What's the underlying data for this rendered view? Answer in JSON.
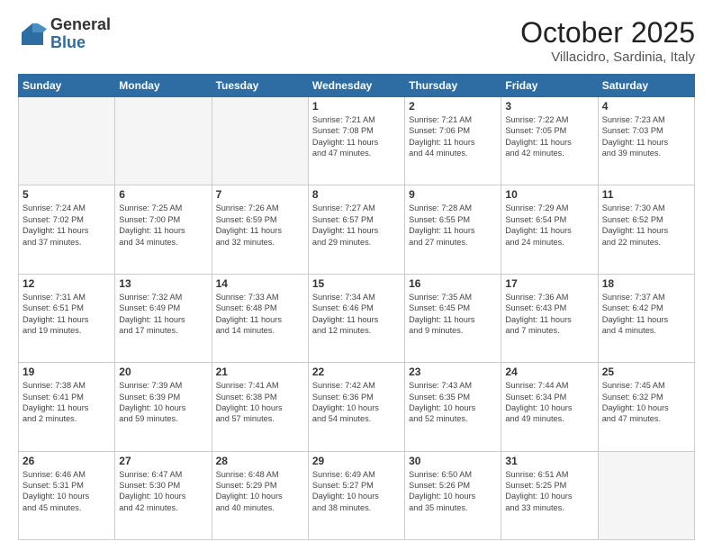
{
  "header": {
    "logo_general": "General",
    "logo_blue": "Blue",
    "month_title": "October 2025",
    "location": "Villacidro, Sardinia, Italy"
  },
  "days_of_week": [
    "Sunday",
    "Monday",
    "Tuesday",
    "Wednesday",
    "Thursday",
    "Friday",
    "Saturday"
  ],
  "weeks": [
    [
      {
        "day": "",
        "info": ""
      },
      {
        "day": "",
        "info": ""
      },
      {
        "day": "",
        "info": ""
      },
      {
        "day": "1",
        "info": "Sunrise: 7:21 AM\nSunset: 7:08 PM\nDaylight: 11 hours\nand 47 minutes."
      },
      {
        "day": "2",
        "info": "Sunrise: 7:21 AM\nSunset: 7:06 PM\nDaylight: 11 hours\nand 44 minutes."
      },
      {
        "day": "3",
        "info": "Sunrise: 7:22 AM\nSunset: 7:05 PM\nDaylight: 11 hours\nand 42 minutes."
      },
      {
        "day": "4",
        "info": "Sunrise: 7:23 AM\nSunset: 7:03 PM\nDaylight: 11 hours\nand 39 minutes."
      }
    ],
    [
      {
        "day": "5",
        "info": "Sunrise: 7:24 AM\nSunset: 7:02 PM\nDaylight: 11 hours\nand 37 minutes."
      },
      {
        "day": "6",
        "info": "Sunrise: 7:25 AM\nSunset: 7:00 PM\nDaylight: 11 hours\nand 34 minutes."
      },
      {
        "day": "7",
        "info": "Sunrise: 7:26 AM\nSunset: 6:59 PM\nDaylight: 11 hours\nand 32 minutes."
      },
      {
        "day": "8",
        "info": "Sunrise: 7:27 AM\nSunset: 6:57 PM\nDaylight: 11 hours\nand 29 minutes."
      },
      {
        "day": "9",
        "info": "Sunrise: 7:28 AM\nSunset: 6:55 PM\nDaylight: 11 hours\nand 27 minutes."
      },
      {
        "day": "10",
        "info": "Sunrise: 7:29 AM\nSunset: 6:54 PM\nDaylight: 11 hours\nand 24 minutes."
      },
      {
        "day": "11",
        "info": "Sunrise: 7:30 AM\nSunset: 6:52 PM\nDaylight: 11 hours\nand 22 minutes."
      }
    ],
    [
      {
        "day": "12",
        "info": "Sunrise: 7:31 AM\nSunset: 6:51 PM\nDaylight: 11 hours\nand 19 minutes."
      },
      {
        "day": "13",
        "info": "Sunrise: 7:32 AM\nSunset: 6:49 PM\nDaylight: 11 hours\nand 17 minutes."
      },
      {
        "day": "14",
        "info": "Sunrise: 7:33 AM\nSunset: 6:48 PM\nDaylight: 11 hours\nand 14 minutes."
      },
      {
        "day": "15",
        "info": "Sunrise: 7:34 AM\nSunset: 6:46 PM\nDaylight: 11 hours\nand 12 minutes."
      },
      {
        "day": "16",
        "info": "Sunrise: 7:35 AM\nSunset: 6:45 PM\nDaylight: 11 hours\nand 9 minutes."
      },
      {
        "day": "17",
        "info": "Sunrise: 7:36 AM\nSunset: 6:43 PM\nDaylight: 11 hours\nand 7 minutes."
      },
      {
        "day": "18",
        "info": "Sunrise: 7:37 AM\nSunset: 6:42 PM\nDaylight: 11 hours\nand 4 minutes."
      }
    ],
    [
      {
        "day": "19",
        "info": "Sunrise: 7:38 AM\nSunset: 6:41 PM\nDaylight: 11 hours\nand 2 minutes."
      },
      {
        "day": "20",
        "info": "Sunrise: 7:39 AM\nSunset: 6:39 PM\nDaylight: 10 hours\nand 59 minutes."
      },
      {
        "day": "21",
        "info": "Sunrise: 7:41 AM\nSunset: 6:38 PM\nDaylight: 10 hours\nand 57 minutes."
      },
      {
        "day": "22",
        "info": "Sunrise: 7:42 AM\nSunset: 6:36 PM\nDaylight: 10 hours\nand 54 minutes."
      },
      {
        "day": "23",
        "info": "Sunrise: 7:43 AM\nSunset: 6:35 PM\nDaylight: 10 hours\nand 52 minutes."
      },
      {
        "day": "24",
        "info": "Sunrise: 7:44 AM\nSunset: 6:34 PM\nDaylight: 10 hours\nand 49 minutes."
      },
      {
        "day": "25",
        "info": "Sunrise: 7:45 AM\nSunset: 6:32 PM\nDaylight: 10 hours\nand 47 minutes."
      }
    ],
    [
      {
        "day": "26",
        "info": "Sunrise: 6:46 AM\nSunset: 5:31 PM\nDaylight: 10 hours\nand 45 minutes."
      },
      {
        "day": "27",
        "info": "Sunrise: 6:47 AM\nSunset: 5:30 PM\nDaylight: 10 hours\nand 42 minutes."
      },
      {
        "day": "28",
        "info": "Sunrise: 6:48 AM\nSunset: 5:29 PM\nDaylight: 10 hours\nand 40 minutes."
      },
      {
        "day": "29",
        "info": "Sunrise: 6:49 AM\nSunset: 5:27 PM\nDaylight: 10 hours\nand 38 minutes."
      },
      {
        "day": "30",
        "info": "Sunrise: 6:50 AM\nSunset: 5:26 PM\nDaylight: 10 hours\nand 35 minutes."
      },
      {
        "day": "31",
        "info": "Sunrise: 6:51 AM\nSunset: 5:25 PM\nDaylight: 10 hours\nand 33 minutes."
      },
      {
        "day": "",
        "info": ""
      }
    ]
  ]
}
